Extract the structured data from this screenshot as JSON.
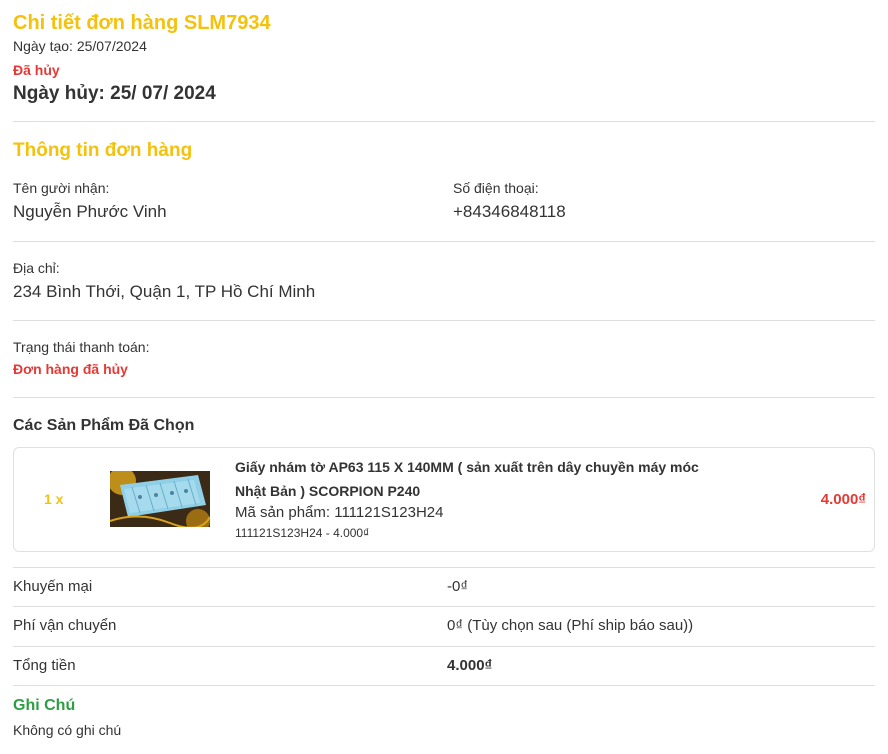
{
  "order": {
    "title": "Chi tiết đơn hàng SLM7934",
    "created": "Ngày tạo: 25/07/2024",
    "status": "Đã hủy",
    "cancel_date": "Ngày hủy: 25/ 07/ 2024"
  },
  "info": {
    "heading": "Thông tin đơn hàng",
    "recipient_label": "Tên gười nhận:",
    "recipient_value": "Nguyễn Phước Vinh",
    "phone_label": "Số điện thoại:",
    "phone_value": "+84346848118",
    "address_label": "Địa chỉ:",
    "address_value": "234 Bình Thới, Quận 1, TP Hồ Chí Minh",
    "payment_label": "Trạng thái thanh toán:",
    "payment_value": "Đơn hàng đã hủy"
  },
  "products": {
    "heading": "Các Sản Phẩm Đã Chọn",
    "items": [
      {
        "qty": "1 x",
        "name_line1": "Giấy nhám tờ AP63 115 X 140MM ( sản xuất trên dây chuyền máy móc",
        "name_line2": "Nhật Bản ) SCORPION P240",
        "code": "Mã sản phẩm: 111121S123H24",
        "variant": "111121S123H24 - 4.000₫",
        "price": "4.000₫",
        "thumb_icon": "sandpaper-photo"
      }
    ]
  },
  "summary": {
    "discount_label": "Khuyến mại",
    "discount_value": "-0₫",
    "shipping_label": "Phí vận chuyển",
    "shipping_value": "0₫ (Tùy chọn sau (Phí ship báo sau))",
    "total_label": "Tổng tiền",
    "total_value": "4.000₫"
  },
  "note": {
    "heading": "Ghi Chú",
    "text": "Không có ghi chú"
  },
  "colors": {
    "accent_yellow": "#f4c20d",
    "cancel_red": "#e53935",
    "note_green": "#2e9e44"
  }
}
